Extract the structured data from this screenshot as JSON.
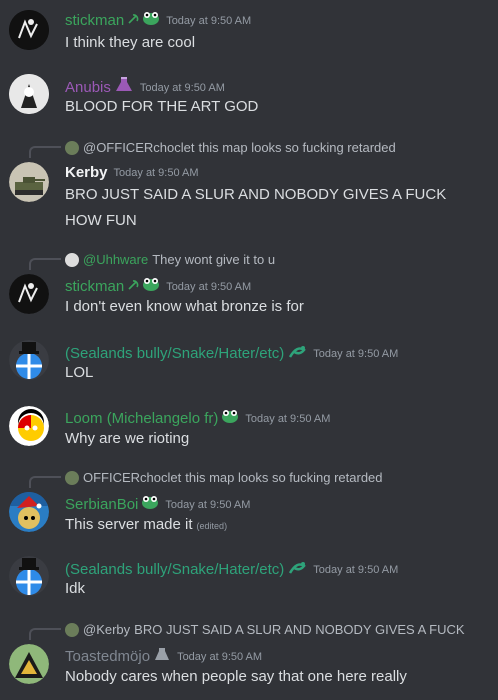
{
  "messages": [
    {
      "username": "stickman",
      "name_color": "#3ba55d",
      "badges": [
        "hammer-sickle-icon",
        "frog-icon"
      ],
      "timestamp": "Today at 9:50 AM",
      "content": "I think they are cool"
    },
    {
      "username": "Anubis",
      "name_color": "#9b59b6",
      "badges": [
        "potion-icon"
      ],
      "timestamp": "Today at 9:50 AM",
      "content": "BLOOD FOR THE ART GOD"
    },
    {
      "reply": {
        "name": "@OFFICERchoclet",
        "text": "this map looks so fucking retarded"
      },
      "username": "Kerby",
      "name_color": "#f2f3f5",
      "timestamp": "Today at 9:50 AM",
      "content": "BRO JUST SAID A SLUR AND NOBODY GIVES A FUCK",
      "content2": "HOW FUN"
    },
    {
      "reply": {
        "name": "@Uhhware",
        "text": "They wont give it to u",
        "name_color": "#3ba55d"
      },
      "username": "stickman",
      "name_color": "#3ba55d",
      "badges": [
        "hammer-sickle-icon",
        "frog-icon"
      ],
      "timestamp": "Today at 9:50 AM",
      "content": "I don't even know what bronze is for"
    },
    {
      "username": "(Sealands bully/Snake/Hater/etc)",
      "name_color": "#2ea37a",
      "badges": [
        "snake-icon"
      ],
      "timestamp": "Today at 9:50 AM",
      "content": "LOL"
    },
    {
      "username": "Loom (Michelangelo fr)",
      "name_color": "#3ba55d",
      "badges": [
        "frog-icon"
      ],
      "timestamp": "Today at 9:50 AM",
      "content": "Why are we rioting"
    },
    {
      "reply": {
        "name": "OFFICERchoclet",
        "text": "this map looks so fucking retarded"
      },
      "username": "SerbianBoi",
      "name_color": "#3ba55d",
      "badges": [
        "frog-icon"
      ],
      "timestamp": "Today at 9:50 AM",
      "content": "This server made it",
      "edited": "(edited)"
    },
    {
      "username": "(Sealands bully/Snake/Hater/etc)",
      "name_color": "#2ea37a",
      "badges": [
        "snake-icon"
      ],
      "timestamp": "Today at 9:50 AM",
      "content": "Idk"
    },
    {
      "reply": {
        "name": "@Kerby",
        "text": "BRO JUST SAID A SLUR AND NOBODY GIVES A FUCK"
      },
      "username": "Toastedmöjo",
      "name_color": "#808791",
      "badges": [
        "potion-grey-icon"
      ],
      "timestamp": "Today at 9:50 AM",
      "content": "Nobody cares when people say that one here really"
    }
  ]
}
